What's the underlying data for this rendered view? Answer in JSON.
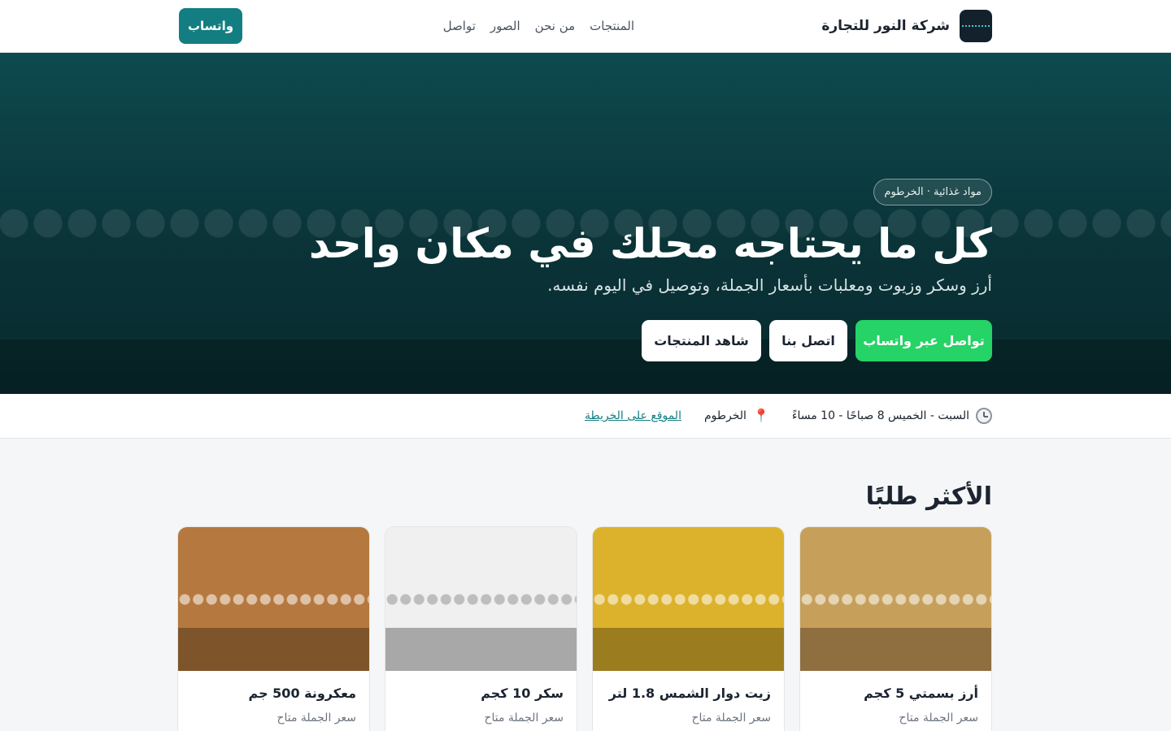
{
  "header": {
    "brand_name": "شركة النور للتجارة",
    "nav": [
      "المنتجات",
      "من نحن",
      "الصور",
      "تواصل"
    ],
    "whatsapp_button": "واتساب"
  },
  "hero": {
    "badge": "مواد غذائية · الخرطوم",
    "title": "كل ما يحتاجه محلك في مكان واحد",
    "subtitle": "أرز وسكر وزيوت ومعلبات بأسعار الجملة، وتوصيل في اليوم نفسه.",
    "cta_whatsapp": "تواصل عبر واتساب",
    "cta_call": "اتصل بنا",
    "cta_products": "شاهد المنتجات"
  },
  "info": {
    "hours": "السبت - الخميس 8 صباحًا - 10 مساءً",
    "location": "الخرطوم",
    "map_link": "الموقع على الخريطة"
  },
  "products": {
    "title": "الأكثر طلبًا",
    "items": [
      {
        "name": "أرز بسمتي 5 كجم",
        "price_note": "سعر الجملة متاح",
        "color_top": "#c6a05a",
        "color_bottom": "#8f6f3f"
      },
      {
        "name": "زيت دوار الشمس 1.8 لتر",
        "price_note": "سعر الجملة متاح",
        "color_top": "#dcb22c",
        "color_bottom": "#9b7c1f"
      },
      {
        "name": "سكر 10 كجم",
        "price_note": "سعر الجملة متاح",
        "color_top": "#f0f0f0",
        "color_bottom": "#a8a8a8"
      },
      {
        "name": "معكرونة 500 جم",
        "price_note": "سعر الجملة متاح",
        "color_top": "#b5783e",
        "color_bottom": "#7e542a"
      }
    ]
  },
  "colors": {
    "accent": "#137e82",
    "whatsapp": "#25d366",
    "hero_bg": "#0a3438"
  },
  "icons": {
    "hours": "clock-icon",
    "location": "map-pin-icon"
  }
}
